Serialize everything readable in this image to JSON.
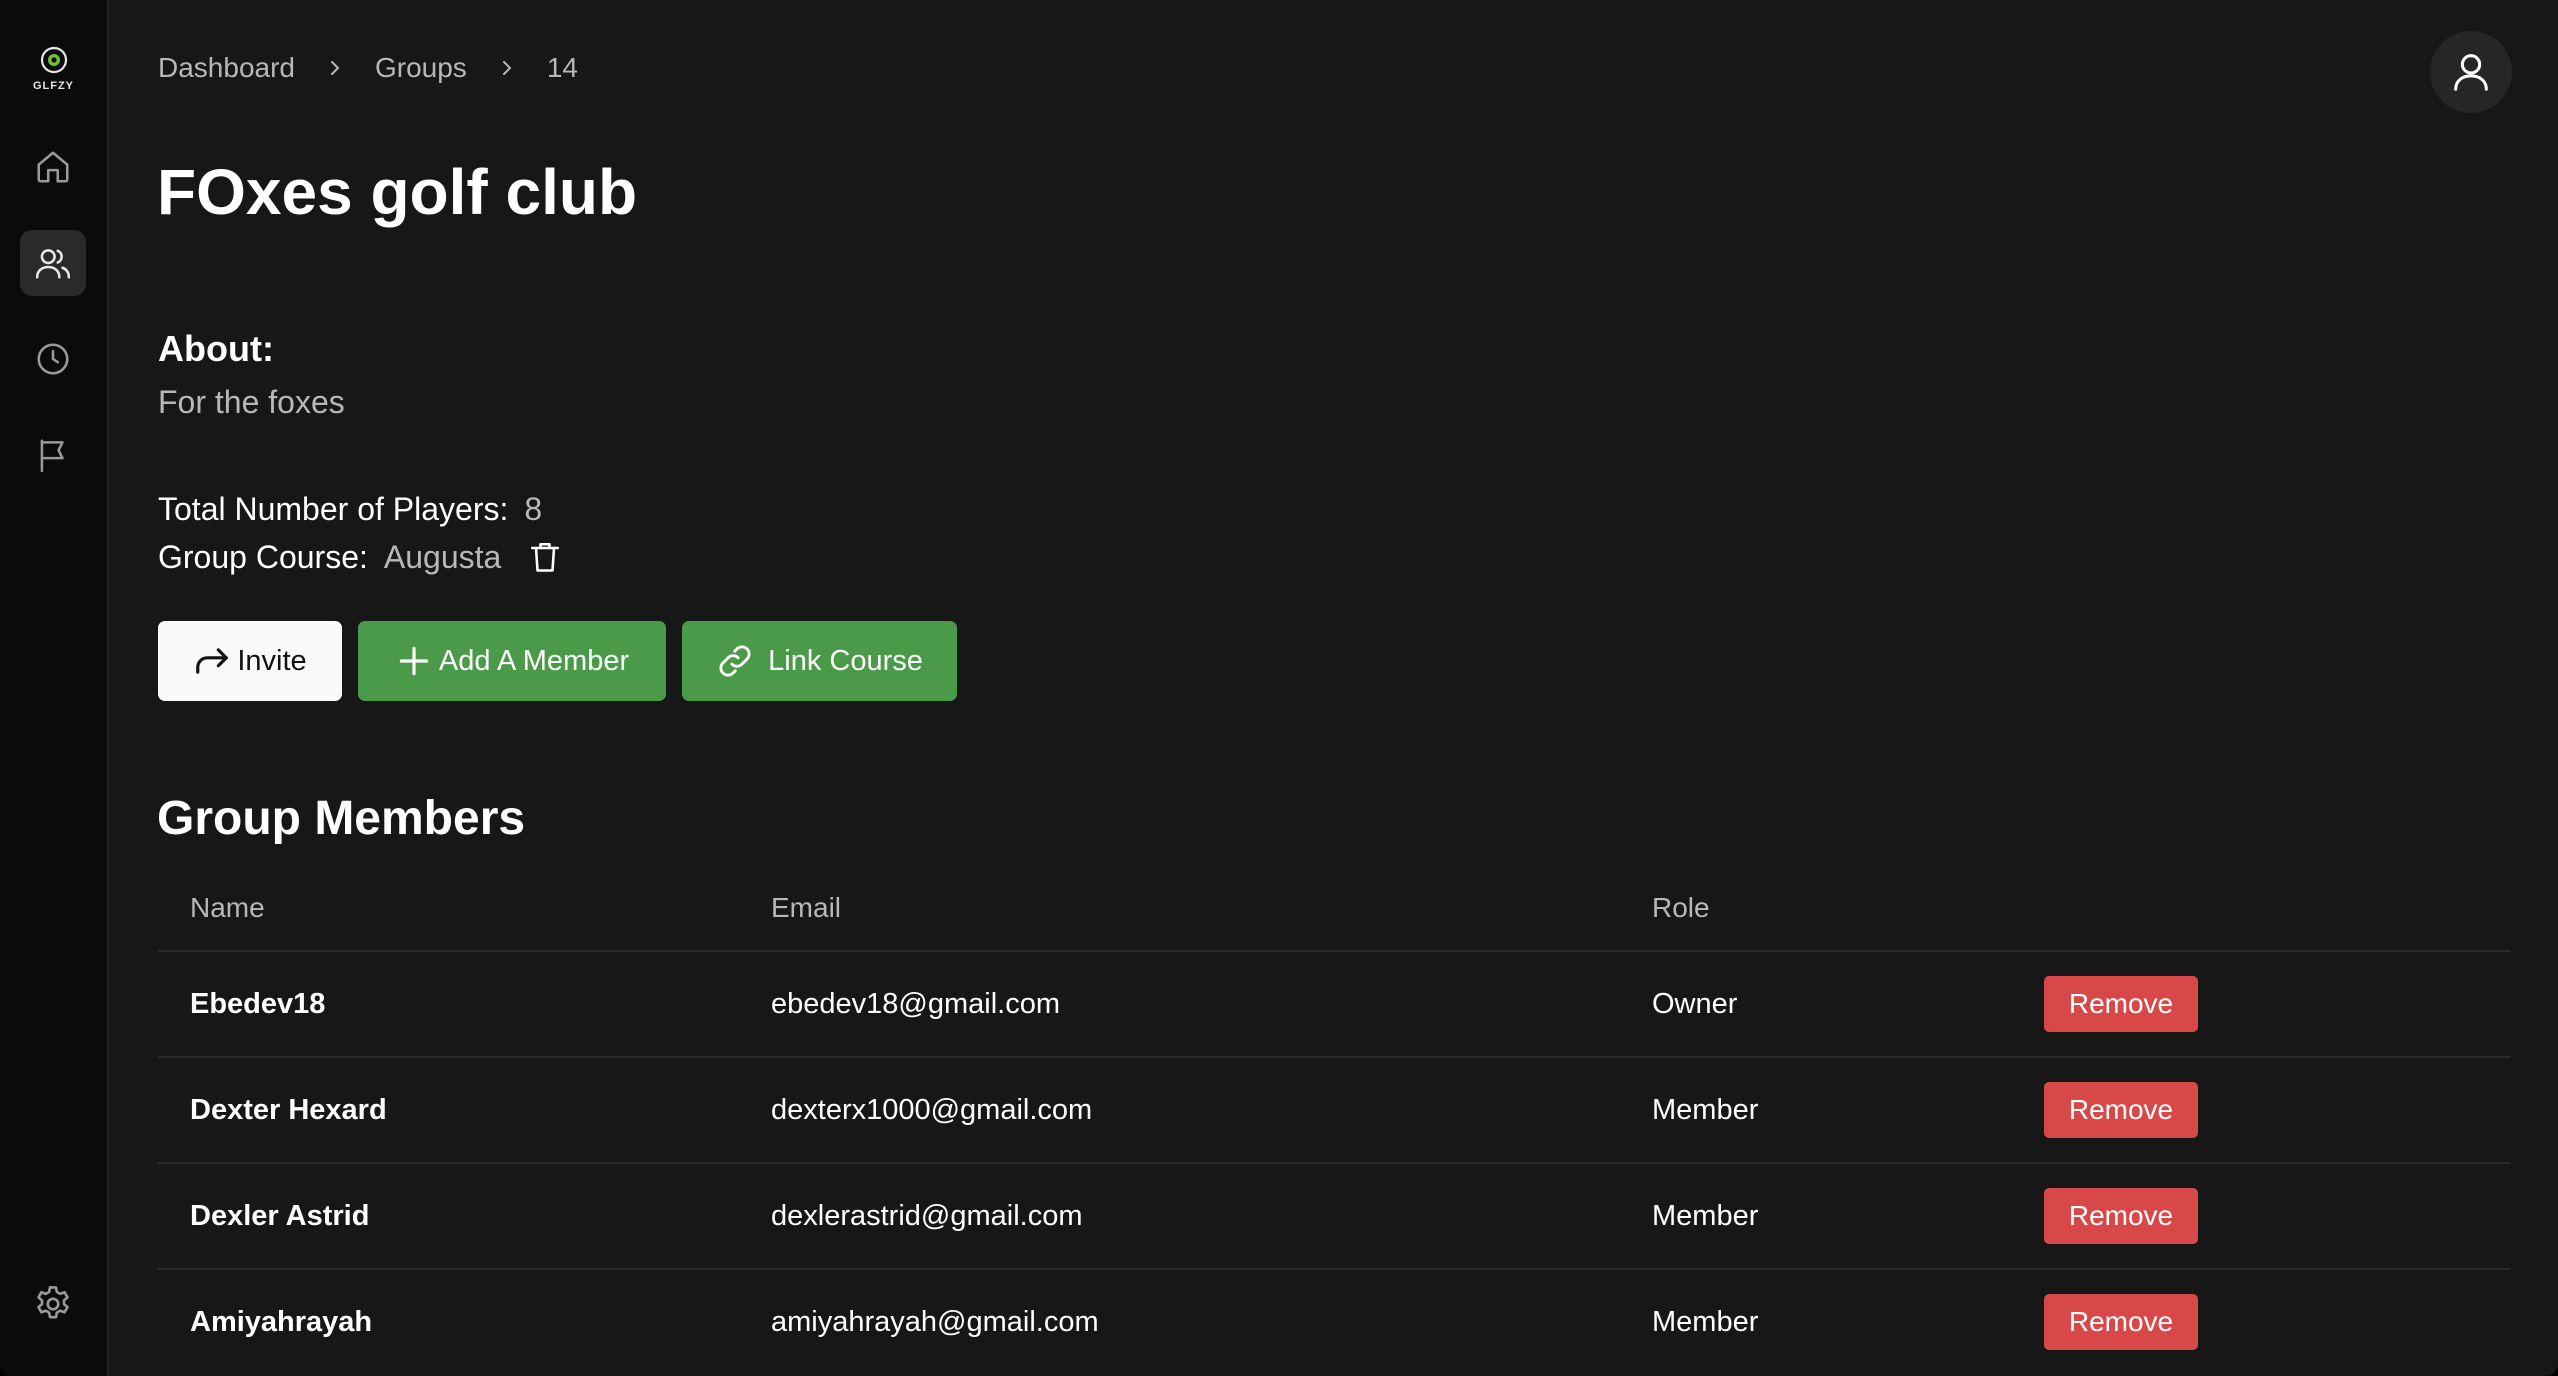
{
  "app": {
    "logo_text": "GLFZY",
    "accent": "#4a9a4a",
    "danger": "#d94848"
  },
  "sidebar": {
    "items": [
      {
        "icon": "home-icon",
        "active": false
      },
      {
        "icon": "users-icon",
        "active": true
      },
      {
        "icon": "clock-icon",
        "active": false
      },
      {
        "icon": "flag-icon",
        "active": false
      }
    ],
    "settings_icon": "gear-icon"
  },
  "breadcrumb": [
    "Dashboard",
    "Groups",
    "14"
  ],
  "group": {
    "name": "FOxes golf club",
    "about_label": "About:",
    "about_text": "For the foxes",
    "players_label": "Total Number of Players:",
    "players_value": "8",
    "course_label": "Group Course:",
    "course_value": "Augusta"
  },
  "actions": {
    "invite": "Invite",
    "add_member": "Add A Member",
    "link_course": "Link Course"
  },
  "members": {
    "title": "Group Members",
    "columns": [
      "Name",
      "Email",
      "Role"
    ],
    "rows": [
      {
        "name": "Ebedev18",
        "email": "ebedev18@gmail.com",
        "role": "Owner",
        "action": "Remove"
      },
      {
        "name": "Dexter Hexard",
        "email": "dexterx1000@gmail.com",
        "role": "Member",
        "action": "Remove"
      },
      {
        "name": "Dexler Astrid",
        "email": "dexlerastrid@gmail.com",
        "role": "Member",
        "action": "Remove"
      },
      {
        "name": "Amiyahrayah",
        "email": "amiyahrayah@gmail.com",
        "role": "Member",
        "action": "Remove"
      }
    ]
  }
}
